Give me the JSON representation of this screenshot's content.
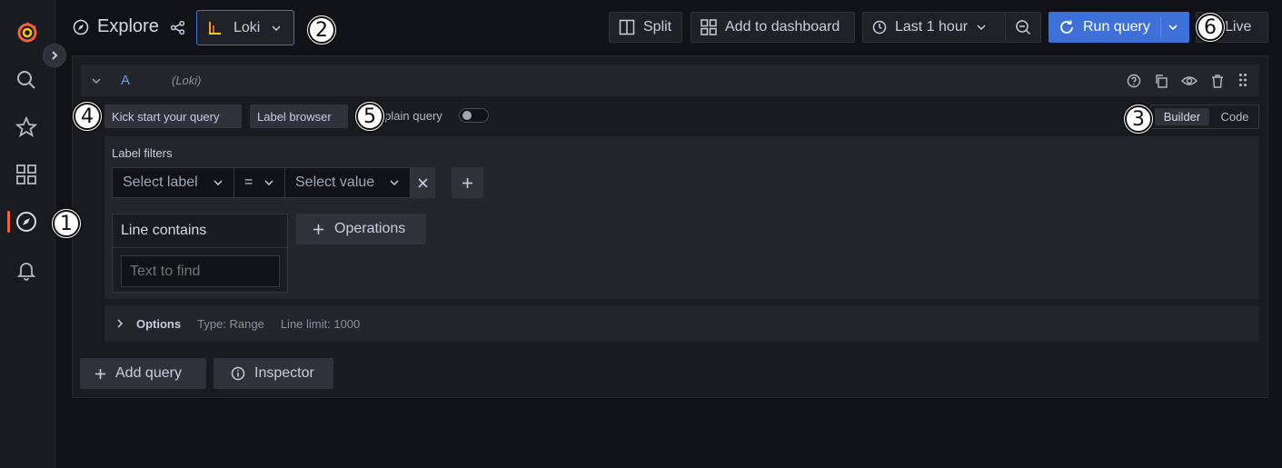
{
  "header": {
    "title": "Explore",
    "datasource": "Loki",
    "split_label": "Split",
    "add_dashboard_label": "Add to dashboard",
    "time_range": "Last 1 hour",
    "run_query_label": "Run query",
    "live_label": "Live"
  },
  "query": {
    "ref_id": "A",
    "datasource_name": "(Loki)",
    "kick_start_label": "Kick start your query",
    "label_browser_label": "Label browser",
    "explain_label": "Explain query",
    "mode_builder": "Builder",
    "mode_code": "Code",
    "label_filters_title": "Label filters",
    "select_label_placeholder": "Select label",
    "operator": "=",
    "select_value_placeholder": "Select value",
    "line_contains_title": "Line contains",
    "text_to_find_placeholder": "Text to find",
    "operations_label": "Operations",
    "options_label": "Options",
    "options_type": "Type: Range",
    "options_line_limit": "Line limit: 1000"
  },
  "footer": {
    "add_query_label": "Add query",
    "inspector_label": "Inspector"
  },
  "callouts": [
    "1",
    "2",
    "3",
    "4",
    "5",
    "6"
  ],
  "colors": {
    "accent": "#3d71d9",
    "logo": "#f55f3e",
    "background": "#111217"
  }
}
